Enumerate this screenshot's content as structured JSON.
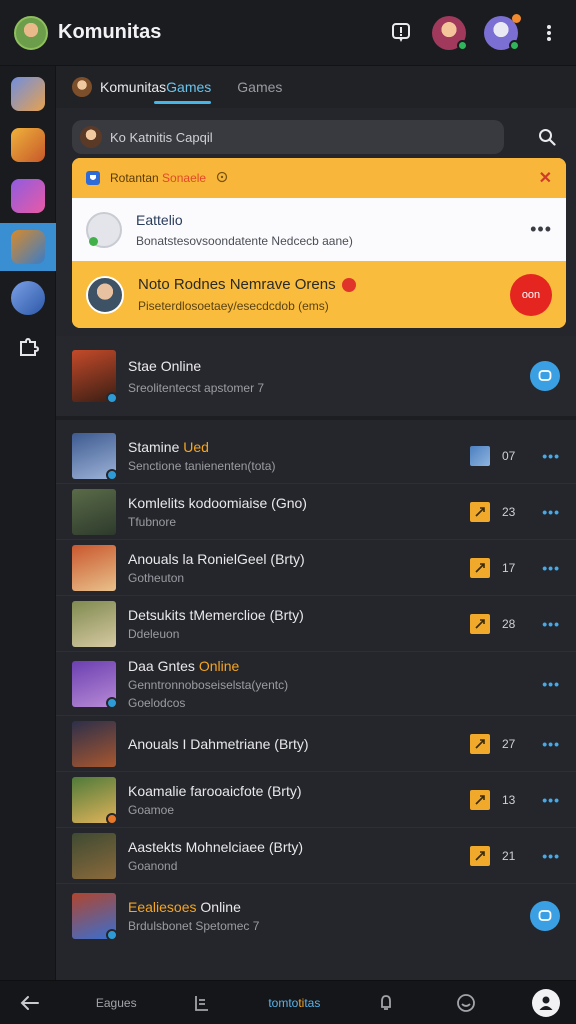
{
  "app": {
    "title": "Komunitas"
  },
  "topbar": {
    "icons": [
      "notification-icon",
      "avatar-1",
      "avatar-2",
      "more-vertical-icon"
    ]
  },
  "rail": {
    "items": [
      {
        "name": "game-1",
        "colors": [
          "#6f8fe0",
          "#e7a14e"
        ]
      },
      {
        "name": "game-2",
        "colors": [
          "#f0b23b",
          "#c6582a"
        ]
      },
      {
        "name": "game-3",
        "colors": [
          "#8e5ce0",
          "#e95aa5"
        ]
      },
      {
        "name": "game-4",
        "colors": [
          "#d88a2b",
          "#3a7cc8"
        ],
        "active": true
      },
      {
        "name": "game-5",
        "colors": [
          "#7aa0e6",
          "#2d58a8"
        ]
      },
      {
        "name": "puzzle",
        "icon": "puzzle-icon"
      }
    ]
  },
  "tabs": [
    {
      "label": "Komunitas",
      "accent": "Games",
      "active": true
    },
    {
      "label": "Games",
      "active": false
    }
  ],
  "search": {
    "text": "Ko Katnitis Capqil"
  },
  "notification": {
    "header_label": "Rotantan",
    "header_accent": "Sonaele",
    "item1_title": "Eattelio",
    "item1_sub": "Bonatstesovsoondatente Nedcecb aane)",
    "item2_title": "Noto Rodnes Nemrave Orens",
    "item2_sub": "Piseterdlosoetaey/esecdcdob (ems)",
    "item2_button": "oon"
  },
  "featured": {
    "title": "Stae Online",
    "sub": "Sreolitentecst apstomer 7"
  },
  "list": [
    {
      "title": "Stamine",
      "accent": "Ued",
      "sub": "Senctione tanienenten(tota)",
      "count": "07",
      "badge": "thumb",
      "colors": [
        "#3d5a8f",
        "#9db3d8"
      ],
      "mini": "blue"
    },
    {
      "title": "Komlelits kodoomiaise (Gno)",
      "sub": "Tfubnore",
      "count": "23",
      "badge": "star",
      "colors": [
        "#5a6b48",
        "#2d3a2c"
      ],
      "mini": "none"
    },
    {
      "title": "Anouals la RonielGeel (Brty)",
      "sub": "Gotheuton",
      "count": "17",
      "badge": "star",
      "colors": [
        "#c9572e",
        "#e9c18b"
      ],
      "mini": "none"
    },
    {
      "title": "Detsukits tMemerclioe (Brty)",
      "sub": "Ddeleuon",
      "count": "28",
      "badge": "star",
      "colors": [
        "#7f8a4f",
        "#d7c9a3"
      ],
      "mini": "none"
    },
    {
      "title": "Daa Gntes",
      "accent": "Online",
      "sub": "Genntronnoboseiselsta(yentc)",
      "sub2": "Goelodcos",
      "count": "",
      "badge": "none",
      "colors": [
        "#6a3fb0",
        "#b88ad6"
      ],
      "mini": "blue",
      "tall": true
    },
    {
      "title": "Anouals I Dahmetriane (Brty)",
      "sub": "",
      "count": "27",
      "badge": "star",
      "colors": [
        "#2c2f4a",
        "#a8572f"
      ],
      "mini": "none"
    },
    {
      "title": "Koamalie farooaicfote (Brty)",
      "sub": "Goamoe",
      "count": "13",
      "badge": "star",
      "colors": [
        "#4f7a3a",
        "#e0b35a"
      ],
      "mini": "orange"
    },
    {
      "title": "Aastekts Mohnelciaee (Brty)",
      "sub": "Goanond",
      "count": "21",
      "badge": "star",
      "colors": [
        "#3e4a32",
        "#8b6a3c"
      ],
      "mini": "none"
    },
    {
      "title": "Eealiesoes",
      "accent_first": true,
      "rest": "Online",
      "sub": "Brdulsbonet Spetomec 7",
      "count": "",
      "badge": "chat",
      "colors": [
        "#b0452e",
        "#3a6fd0"
      ],
      "mini": "blue"
    }
  ],
  "bottombar": {
    "back_icon": "arrow-left-icon",
    "item1": "Eagues",
    "item2_icon": "list-icon",
    "item3": "tomtotitas",
    "item4_icon": "bell-icon",
    "item5_icon": "smile-icon",
    "item6_icon": "profile-icon"
  }
}
